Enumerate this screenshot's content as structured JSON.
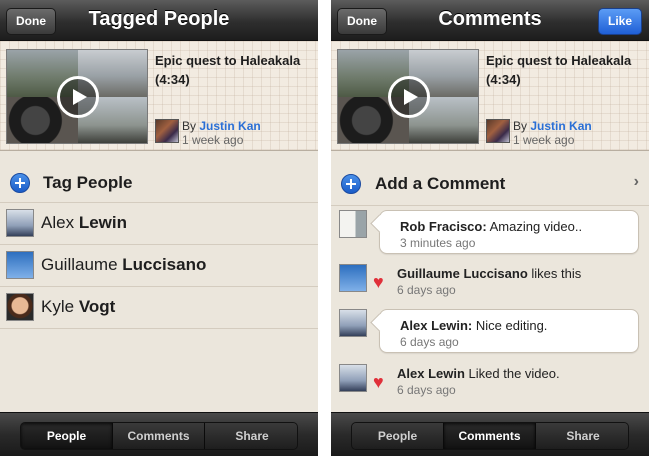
{
  "left": {
    "nav": {
      "title": "Tagged People",
      "done_label": "Done"
    },
    "video": {
      "title": "Epic quest to Haleakala (4:34)",
      "by": "By",
      "author": "Justin Kan",
      "time": "1 week ago"
    },
    "tag_people_label": "Tag People",
    "people": [
      {
        "first": "Alex",
        "last": "Lewin"
      },
      {
        "first": "Guillaume",
        "last": "Luccisano"
      },
      {
        "first": "Kyle",
        "last": "Vogt"
      }
    ],
    "tabs": [
      "People",
      "Comments",
      "Share"
    ],
    "active_tab": "People"
  },
  "right": {
    "nav": {
      "title": "Comments",
      "done_label": "Done",
      "like_label": "Like"
    },
    "video": {
      "title": "Epic quest to Haleakala (4:34)",
      "by": "By",
      "author": "Justin Kan",
      "time": "1 week ago"
    },
    "add_comment_label": "Add a Comment",
    "feed": [
      {
        "type": "comment",
        "name": "Rob Fracisco:",
        "text": "Amazing video..",
        "time": "3 minutes ago"
      },
      {
        "type": "like",
        "name": "Guillaume Luccisano",
        "text": "likes this",
        "time": "6 days ago"
      },
      {
        "type": "comment",
        "name": "Alex Lewin:",
        "text": "Nice editing.",
        "time": "6 days ago"
      },
      {
        "type": "like",
        "name": "Alex Lewin",
        "text": "Liked the video.",
        "time": "6 days ago"
      }
    ],
    "tabs": [
      "People",
      "Comments",
      "Share"
    ],
    "active_tab": "Comments"
  },
  "colors": {
    "accent_blue": "#2a6fd6",
    "like_button": "#1f5fd6",
    "heart": "#e0303a",
    "background": "#ebe6dc"
  },
  "icons": {
    "play": "play-icon",
    "add": "plus-circle-icon",
    "like": "heart-icon",
    "disclosure": "chevron-right-icon"
  }
}
